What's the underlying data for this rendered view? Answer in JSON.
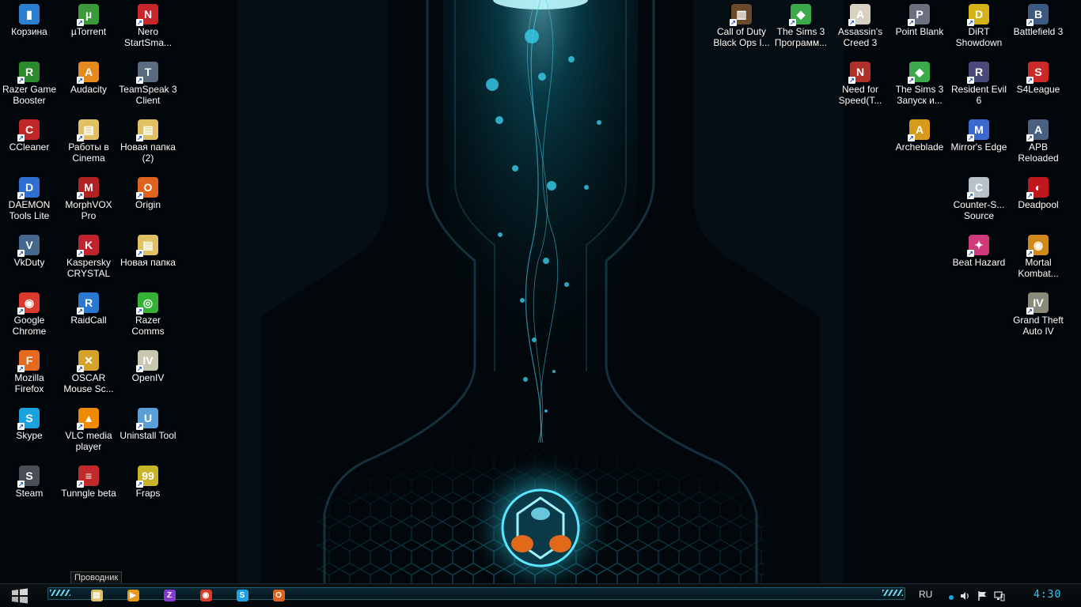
{
  "desktop": {
    "left_icons": [
      {
        "label": "Корзина",
        "icon": "recycle-bin-icon",
        "color": "#2a7fd1",
        "glyph": "▮"
      },
      {
        "label": "µTorrent",
        "icon": "utorrent-icon",
        "color": "#3a9a3a",
        "glyph": "µ"
      },
      {
        "label": "Nero StartSma...",
        "icon": "nero-icon",
        "color": "#c8262a",
        "glyph": "N"
      },
      {
        "label": "Razer Game Booster",
        "icon": "razer-game-booster-icon",
        "color": "#2b8a2b",
        "glyph": "R"
      },
      {
        "label": "Audacity",
        "icon": "audacity-icon",
        "color": "#e68a1e",
        "glyph": "A"
      },
      {
        "label": "TeamSpeak 3 Client",
        "icon": "teamspeak-icon",
        "color": "#5a6b80",
        "glyph": "T"
      },
      {
        "label": "CCleaner",
        "icon": "ccleaner-icon",
        "color": "#c02828",
        "glyph": "C"
      },
      {
        "label": "Работы в Cinema",
        "icon": "folder-icon",
        "color": "#e0c060",
        "glyph": "▤"
      },
      {
        "label": "Новая папка (2)",
        "icon": "folder-icon",
        "color": "#e0c060",
        "glyph": "▤"
      },
      {
        "label": "DAEMON Tools Lite",
        "icon": "daemon-tools-icon",
        "color": "#2f6fd4",
        "glyph": "D"
      },
      {
        "label": "MorphVOX Pro",
        "icon": "morphvox-icon",
        "color": "#b22222",
        "glyph": "M"
      },
      {
        "label": "Origin",
        "icon": "origin-icon",
        "color": "#e0621c",
        "glyph": "O"
      },
      {
        "label": "VkDuty",
        "icon": "vkduty-icon",
        "color": "#45688e",
        "glyph": "V"
      },
      {
        "label": "Kaspersky CRYSTAL",
        "icon": "kaspersky-icon",
        "color": "#c0222e",
        "glyph": "K"
      },
      {
        "label": "Новая папка",
        "icon": "folder-icon",
        "color": "#e0c060",
        "glyph": "▤"
      },
      {
        "label": "Google Chrome",
        "icon": "chrome-icon",
        "color": "#d93a2b",
        "glyph": "◉"
      },
      {
        "label": "RaidCall",
        "icon": "raidcall-icon",
        "color": "#2a78d0",
        "glyph": "R"
      },
      {
        "label": "Razer Comms",
        "icon": "razer-comms-icon",
        "color": "#34b234",
        "glyph": "◎"
      },
      {
        "label": "Mozilla Firefox",
        "icon": "firefox-icon",
        "color": "#e56a1e",
        "glyph": "F"
      },
      {
        "label": "OSCAR Mouse Sc...",
        "icon": "oscar-icon",
        "color": "#d4a12a",
        "glyph": "✕"
      },
      {
        "label": "OpenIV",
        "icon": "openiv-icon",
        "color": "#c8c8b0",
        "glyph": "IV"
      },
      {
        "label": "Skype",
        "icon": "skype-icon",
        "color": "#1aa3e0",
        "glyph": "S"
      },
      {
        "label": "VLC media player",
        "icon": "vlc-icon",
        "color": "#f08a00",
        "glyph": "▲"
      },
      {
        "label": "Uninstall Tool",
        "icon": "uninstall-tool-icon",
        "color": "#5aa0d8",
        "glyph": "U"
      },
      {
        "label": "Steam",
        "icon": "steam-icon",
        "color": "#4a4f57",
        "glyph": "S"
      },
      {
        "label": "Tunngle beta",
        "icon": "tunngle-icon",
        "color": "#c02a2a",
        "glyph": "≡"
      },
      {
        "label": "Fraps",
        "icon": "fraps-icon",
        "color": "#c8b428",
        "glyph": "99"
      }
    ],
    "right_icons": [
      {
        "label": "Call of Duty Black Ops I...",
        "icon": "call-of-duty-icon",
        "color": "#6a4a2a",
        "glyph": "▥"
      },
      {
        "label": "The Sims 3 Программ...",
        "icon": "sims3-icon",
        "color": "#3aaa4a",
        "glyph": "◆"
      },
      {
        "label": "Assassin's Creed 3",
        "icon": "assassins-creed-icon",
        "color": "#d8d0c0",
        "glyph": "A"
      },
      {
        "label": "Point Blank",
        "icon": "point-blank-icon",
        "color": "#6a7080",
        "glyph": "P"
      },
      {
        "label": "DiRT Showdown",
        "icon": "dirt-showdown-icon",
        "color": "#d6b21a",
        "glyph": "D"
      },
      {
        "label": "Battlefield 3",
        "icon": "battlefield3-icon",
        "color": "#3c5a80",
        "glyph": "B"
      },
      {
        "label": "Need for Speed(T...",
        "icon": "need-for-speed-icon",
        "color": "#b0302a",
        "glyph": "N"
      },
      {
        "label": "The Sims 3 Запуск и...",
        "icon": "sims3-icon",
        "color": "#3aaa4a",
        "glyph": "◆"
      },
      {
        "label": "Resident Evil 6",
        "icon": "resident-evil-icon",
        "color": "#4a4a7a",
        "glyph": "R"
      },
      {
        "label": "S4League",
        "icon": "s4league-icon",
        "color": "#cc2a2a",
        "glyph": "S"
      },
      {
        "label": "Archeblade",
        "icon": "archeblade-icon",
        "color": "#d89a1a",
        "glyph": "A"
      },
      {
        "label": "Mirror's Edge",
        "icon": "mirrors-edge-icon",
        "color": "#3a6ad0",
        "glyph": "M"
      },
      {
        "label": "APB Reloaded",
        "icon": "apb-reloaded-icon",
        "color": "#4a6080",
        "glyph": "A"
      },
      {
        "label": "Counter-S... Source",
        "icon": "counter-strike-icon",
        "color": "#b8c0c8",
        "glyph": "C"
      },
      {
        "label": "Deadpool",
        "icon": "deadpool-icon",
        "color": "#c0161e",
        "glyph": "◐"
      },
      {
        "label": "Beat Hazard",
        "icon": "beat-hazard-icon",
        "color": "#d03a7a",
        "glyph": "✦"
      },
      {
        "label": "Mortal Kombat...",
        "icon": "mortal-kombat-icon",
        "color": "#d08a1a",
        "glyph": "◉"
      },
      {
        "label": "Grand Theft Auto IV",
        "icon": "gta4-icon",
        "color": "#8a8a7a",
        "glyph": "IV"
      }
    ]
  },
  "tooltip": {
    "text": "Проводник"
  },
  "taskbar": {
    "apps": [
      {
        "name": "explorer",
        "icon": "folder-icon",
        "color": "#e0c060",
        "glyph": "▤"
      },
      {
        "name": "media",
        "icon": "media-player-icon",
        "color": "#e89a1a",
        "glyph": "▶"
      },
      {
        "name": "z-app",
        "icon": "z-app-icon",
        "color": "#8a3ad0",
        "glyph": "Z"
      },
      {
        "name": "chrome",
        "icon": "chrome-icon",
        "color": "#d93a2b",
        "glyph": "◉"
      },
      {
        "name": "skype",
        "icon": "skype-icon",
        "color": "#1aa3e0",
        "glyph": "S"
      },
      {
        "name": "origin",
        "icon": "origin-icon",
        "color": "#e0621c",
        "glyph": "O"
      }
    ],
    "language": "RU",
    "clock": "4:30"
  },
  "colors": {
    "accent": "#38c8f0",
    "glow": "#1fc3e6",
    "background": "#02070b"
  }
}
